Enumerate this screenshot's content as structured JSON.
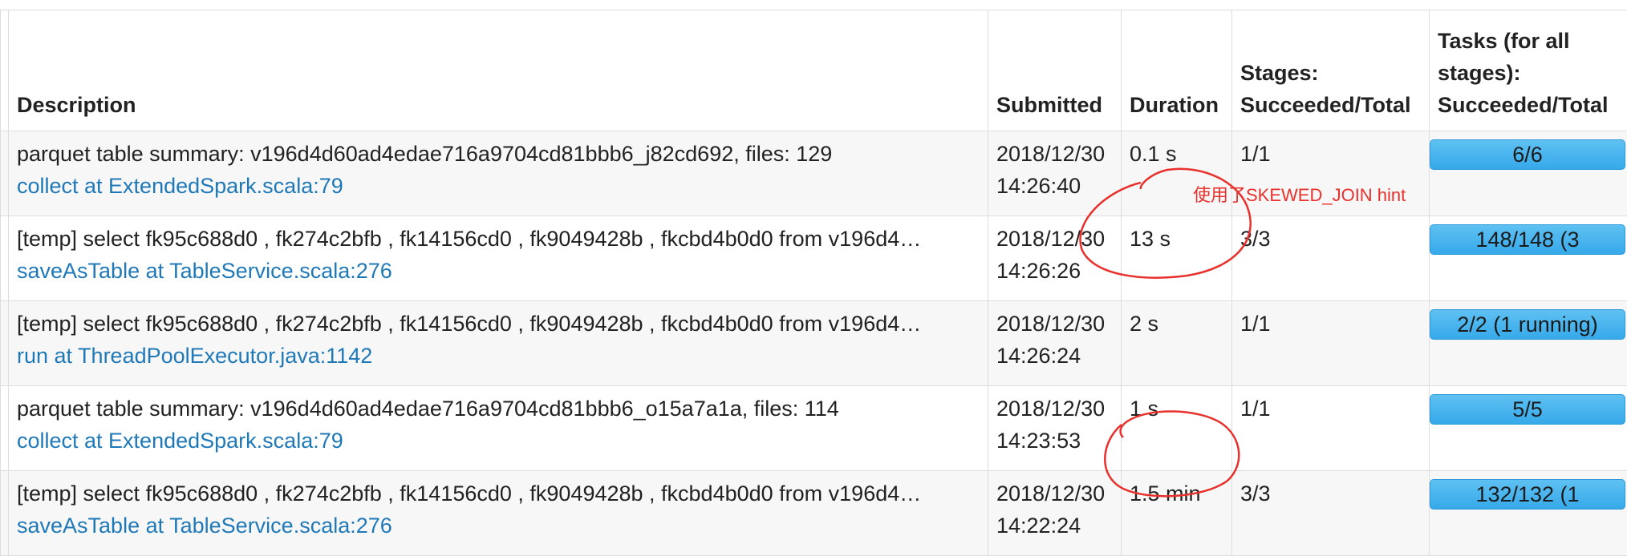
{
  "headers": {
    "description": "Description",
    "submitted": "Submitted",
    "duration": "Duration",
    "stages": "Stages: Succeeded/Total",
    "tasks": "Tasks (for all stages): Succeeded/Total"
  },
  "rows": [
    {
      "description": "parquet table summary: v196d4d60ad4edae716a9704cd81bbb6_j82cd692, files: 129",
      "link": "collect at ExtendedSpark.scala:79",
      "submitted_date": "2018/12/30",
      "submitted_time": "14:26:40",
      "duration": "0.1 s",
      "stages": "1/1",
      "tasks": "6/6",
      "task_progress": 1.0
    },
    {
      "description": "[temp] select fk95c688d0 , fk274c2bfb , fk14156cd0 , fk9049428b , fkcbd4b0d0 from v196d4…",
      "link": "saveAsTable at TableService.scala:276",
      "submitted_date": "2018/12/30",
      "submitted_time": "14:26:26",
      "duration": "13 s",
      "stages": "3/3",
      "tasks": "148/148 (3",
      "task_progress": 1.0
    },
    {
      "description": "[temp] select fk95c688d0 , fk274c2bfb , fk14156cd0 , fk9049428b , fkcbd4b0d0 from v196d4…",
      "link": "run at ThreadPoolExecutor.java:1142",
      "submitted_date": "2018/12/30",
      "submitted_time": "14:26:24",
      "duration": "2 s",
      "stages": "1/1",
      "tasks": "2/2 (1 running)",
      "task_progress": 1.0
    },
    {
      "description": "parquet table summary: v196d4d60ad4edae716a9704cd81bbb6_o15a7a1a, files: 114",
      "link": "collect at ExtendedSpark.scala:79",
      "submitted_date": "2018/12/30",
      "submitted_time": "14:23:53",
      "duration": "1 s",
      "stages": "1/1",
      "tasks": "5/5",
      "task_progress": 1.0
    },
    {
      "description": "[temp] select fk95c688d0 , fk274c2bfb , fk14156cd0 , fk9049428b , fkcbd4b0d0 from v196d4…",
      "link": "saveAsTable at TableService.scala:276",
      "submitted_date": "2018/12/30",
      "submitted_time": "14:22:24",
      "duration": "1.5 min",
      "stages": "3/3",
      "tasks": "132/132 (1",
      "task_progress": 1.0
    }
  ],
  "annotation": {
    "hint": "使用了SKEWED_JOIN hint",
    "color": "#e8302c"
  },
  "colors": {
    "link": "#1f79b8",
    "progress_bar": "#36a9ea",
    "row_stripe": "#f7f7f7",
    "border": "#dddddd"
  }
}
